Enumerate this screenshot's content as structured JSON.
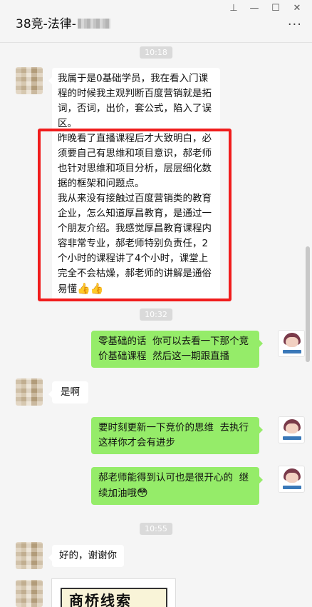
{
  "window": {
    "title": "38竞-法律-",
    "pin_glyph": "⊥",
    "minimize_glyph": "—",
    "maximize_glyph": "☐",
    "close_glyph": "✕",
    "more_glyph": "···"
  },
  "messages": {
    "t1": "10:18",
    "m1": "我属于是0基础学员，我在看入门课程的时候我主观判断百度营销就是拓词，否词，出价，套公式，陷入了误区。",
    "m1b": "昨晚看了直播课程后才大致明白，必须要自己有思维和项目意识，郝老师也针对思维和项目分析，层层细化数据的框架和问题点。",
    "m1c": "我从来没有接触过百度营销类的教育企业，怎么知道厚昌教育，是通过一个朋友介绍。我感觉厚昌教育课程内容非常专业，郝老师特别负责任，2个小时的课程讲了4个小时，课堂上完全不会枯燥，郝老师的讲解是通俗易懂",
    "m1_emoji": "👍👍",
    "t2": "10:32",
    "m2": "零基础的话  你可以去看一下那个竞价基础课程  然后这一期跟直播",
    "m3": "是啊",
    "m4": "要时刻更新一下竞价的思维  去执行  这样你才会有进步",
    "m5": "郝老师能得到认可也是很开心的  继续加油哦",
    "m5_emoji": "😳",
    "t3": "10:55",
    "m6": "好的，谢谢你",
    "m7_image_text": "商桥线索"
  },
  "colors": {
    "sent_bubble": "#95ec69",
    "received_bubble": "#ffffff",
    "highlight_box": "#f01c1c"
  },
  "icons": [
    "pin-icon",
    "minimize-icon",
    "maximize-icon",
    "close-icon",
    "more-icon"
  ]
}
